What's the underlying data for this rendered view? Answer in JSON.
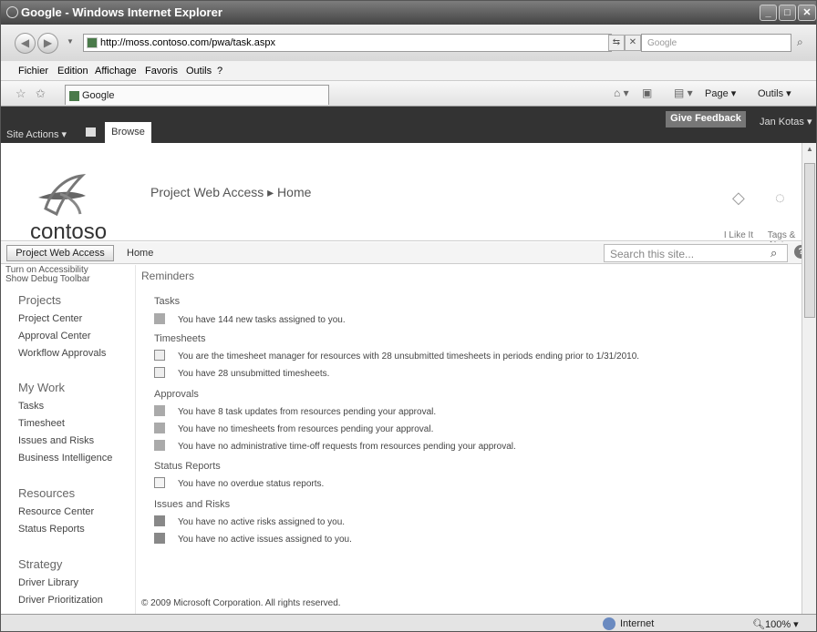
{
  "browser": {
    "title": "Google - Windows Internet Explorer",
    "url": "http://moss.contoso.com/pwa/task.aspx",
    "search_placeholder": "Google",
    "menu": [
      "Fichier",
      "Edition",
      "Affichage",
      "Favoris",
      "Outils",
      "?"
    ],
    "tab_label": "Google",
    "cmd_page": "Page",
    "cmd_tools": "Outils",
    "status_zone": "Internet",
    "zoom": "100%"
  },
  "ribbon": {
    "site_actions": "Site Actions",
    "browse": "Browse",
    "feedback": "Give Feedback",
    "user": "Jan Kotas"
  },
  "header": {
    "logo_text": "contoso",
    "breadcrumb": "Project Web Access ▸ Home",
    "ilike": "I Like It",
    "tags_notes": "Tags & Notes"
  },
  "topnav": {
    "pwa": "Project Web Access",
    "home": "Home",
    "search_placeholder": "Search this site..."
  },
  "leftnav": {
    "accessibility": "Turn on Accessibility",
    "debug": "Show Debug Toolbar",
    "projects": "Projects",
    "project_center": "Project Center",
    "approval_center": "Approval Center",
    "workflow_approvals": "Workflow Approvals",
    "my_work": "My Work",
    "tasks": "Tasks",
    "timesheet": "Timesheet",
    "issues_risks": "Issues and Risks",
    "bi": "Business Intelligence",
    "resources": "Resources",
    "resource_center": "Resource Center",
    "status_reports": "Status Reports",
    "strategy": "Strategy",
    "driver_library": "Driver Library",
    "driver_prioritization": "Driver Prioritization"
  },
  "main": {
    "reminders": "Reminders",
    "tasks_hdr": "Tasks",
    "tasks_msg": "You have 144 new tasks assigned to you.",
    "timesheets_hdr": "Timesheets",
    "ts_msg1": "You are the timesheet manager for resources with 28 unsubmitted timesheets in periods ending prior to 1/31/2010.",
    "ts_msg2": "You have 28 unsubmitted timesheets.",
    "approvals_hdr": "Approvals",
    "ap_msg1": "You have 8 task updates from resources pending your approval.",
    "ap_msg2": "You have no timesheets from resources pending your approval.",
    "ap_msg3": "You have no administrative time-off requests from resources pending your approval.",
    "sr_hdr": "Status Reports",
    "sr_msg": "You have no overdue status reports.",
    "ir_hdr": "Issues and Risks",
    "ir_msg1": "You have no active risks assigned to you.",
    "ir_msg2": "You have no active issues assigned to you.",
    "copyright": "© 2009 Microsoft Corporation. All rights reserved."
  }
}
